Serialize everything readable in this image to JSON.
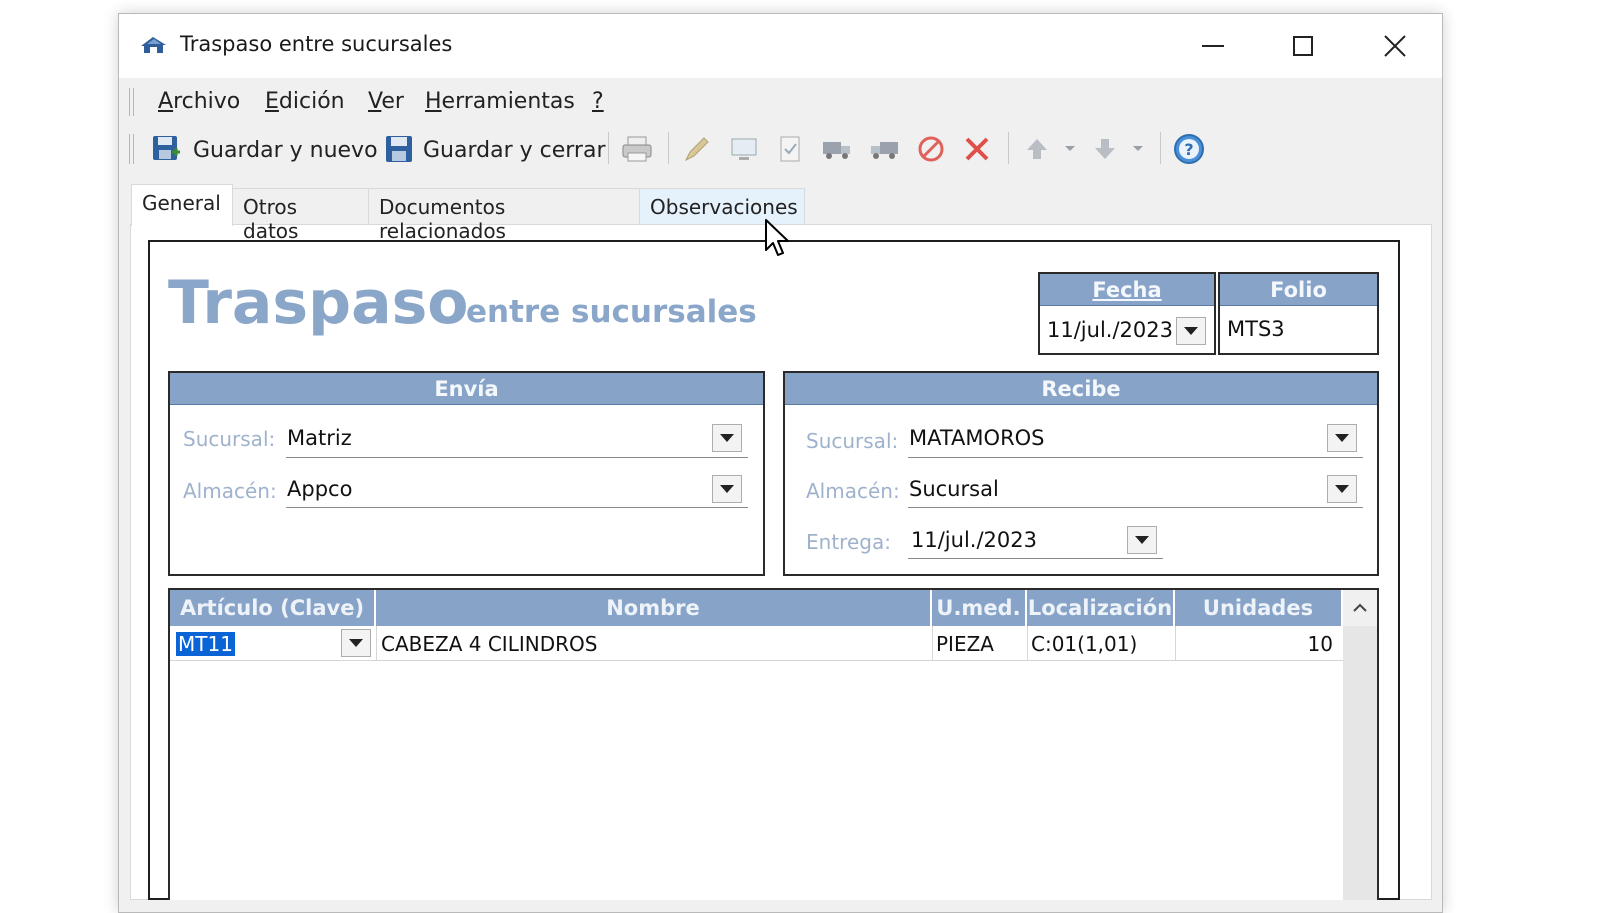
{
  "window": {
    "title": "Traspaso entre sucursales"
  },
  "menu": {
    "items": [
      {
        "underline": "A",
        "rest": "rchivo"
      },
      {
        "underline": "E",
        "rest": "dición"
      },
      {
        "underline": "V",
        "rest": "er"
      },
      {
        "underline": "H",
        "rest": "erramientas"
      },
      {
        "underline": "?",
        "rest": ""
      }
    ]
  },
  "toolbar": {
    "save_new_label": "Guardar y nuevo",
    "save_close_label": "Guardar y cerrar",
    "icons": [
      "print-icon",
      "pencil-icon",
      "monitor-icon",
      "checklist-icon",
      "truck-icon",
      "truck-back-icon",
      "cancel-icon",
      "delete-icon",
      "up-arrow-icon",
      "down-arrow-icon",
      "help-icon"
    ]
  },
  "tabs": [
    {
      "label": "General"
    },
    {
      "label": "Otros datos"
    },
    {
      "label": "Documentos relacionados"
    },
    {
      "label": "Observaciones"
    }
  ],
  "form": {
    "title_big": "Traspaso",
    "title_small": "entre sucursales",
    "fecha": {
      "label": "Fecha",
      "value": "11/jul./2023"
    },
    "folio": {
      "label": "Folio",
      "value": "MTS3"
    },
    "envia": {
      "caption": "Envía",
      "sucursal_label": "Sucursal:",
      "sucursal_value": "Matriz",
      "almacen_label": "Almacén:",
      "almacen_value": "Appco"
    },
    "recibe": {
      "caption": "Recibe",
      "sucursal_label": "Sucursal:",
      "sucursal_value": "MATAMOROS",
      "almacen_label": "Almacén:",
      "almacen_value": "Sucursal",
      "entrega_label": "Entrega:",
      "entrega_value": "11/jul./2023"
    }
  },
  "grid": {
    "columns": [
      "Artículo (Clave)",
      "Nombre",
      "U.med.",
      "Localización",
      "Unidades"
    ],
    "rows": [
      {
        "clave": "MT11",
        "nombre": "CABEZA 4 CILINDROS",
        "umed": "PIEZA",
        "localizacion": "C:01(1,01)",
        "unidades": "10"
      }
    ]
  },
  "colors": {
    "header_blue": "#87a4c8",
    "title_blue": "#8aa6c9",
    "label_blue": "#9fb2cc",
    "selection": "#0a64d6"
  }
}
